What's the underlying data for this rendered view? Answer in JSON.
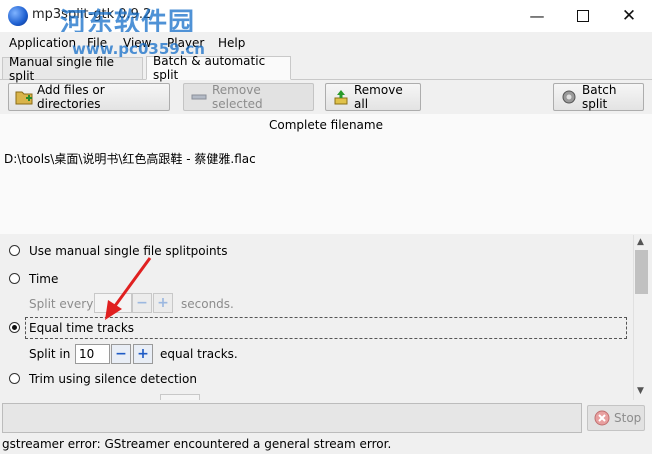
{
  "window": {
    "title": "mp3split-gtk 0.9.2",
    "watermark_cn": "河东软件园",
    "watermark_url": "www.pc0359.cn"
  },
  "menu": [
    "Application",
    "File",
    "View",
    "Player",
    "Help"
  ],
  "tabs": [
    {
      "label": "Manual single file split",
      "active": false
    },
    {
      "label": "Batch & automatic split",
      "active": true
    }
  ],
  "toolbar": {
    "add_label": "Add files or directories",
    "remove_selected_label": "Remove selected",
    "remove_all_label": "Remove all",
    "batch_split_label": "Batch split"
  },
  "file_list": {
    "column_header": "Complete filename",
    "rows": [
      "D:\\tools\\桌面\\说明书\\红色高跟鞋 - 蔡健雅.flac"
    ]
  },
  "options": {
    "manual_label": "Use manual single file splitpoints",
    "time_label": "Time",
    "split_every_label": "Split every",
    "seconds_label": "seconds.",
    "equal_label": "Equal time tracks",
    "split_in_label": "Split in",
    "split_in_value": "10",
    "equal_tracks_label": "equal tracks.",
    "silence_label": "Trim using silence detection",
    "selected": "equal"
  },
  "bottom": {
    "stop_label": "Stop",
    "status": "gstreamer error: GStreamer encountered a general stream error."
  },
  "colors": {
    "accent": "#1e5bc6",
    "arrow": "#e02020",
    "watermark": "#146ec8"
  },
  "icons": [
    "app-icon",
    "minimize-icon",
    "maximize-icon",
    "close-icon",
    "add-folder-icon",
    "remove-icon",
    "remove-all-icon",
    "batch-split-icon",
    "stop-icon"
  ]
}
